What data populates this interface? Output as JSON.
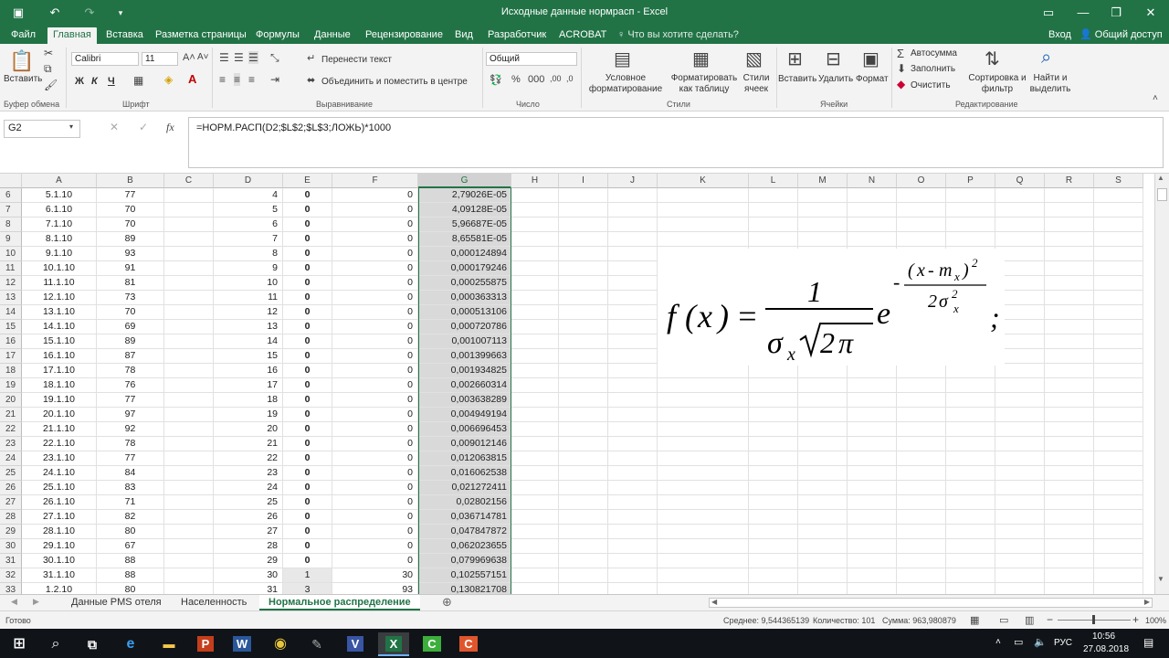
{
  "window": {
    "title": "Исходные данные нормрасп - Excel"
  },
  "menu": {
    "tabs": [
      "Файл",
      "Главная",
      "Вставка",
      "Разметка страницы",
      "Формулы",
      "Данные",
      "Рецензирование",
      "Вид",
      "Разработчик",
      "ACROBAT"
    ],
    "tell_me": "Что вы хотите сделать?",
    "signin": "Вход",
    "share": "Общий доступ"
  },
  "ribbon": {
    "paste_label": "Вставить",
    "clipboard_group": "Буфер обмена",
    "font_name": "Calibri",
    "font_size": "11",
    "font_group": "Шрифт",
    "bold": "Ж",
    "italic": "К",
    "underline": "Ч",
    "wrap_text": "Перенести текст",
    "merge_center": "Объединить и поместить в центре",
    "alignment_group": "Выравнивание",
    "number_format": "Общий",
    "number_group": "Число",
    "conditional_formatting": "Условное форматирование",
    "format_as_table": "Форматировать как таблицу",
    "cell_styles": "Стили ячеек",
    "styles_group": "Стили",
    "insert": "Вставить",
    "delete": "Удалить",
    "format": "Формат",
    "cells_group": "Ячейки",
    "autosum": "Автосумма",
    "fill": "Заполнить",
    "clear": "Очистить",
    "sort_filter": "Сортировка и фильтр",
    "find_select": "Найти и выделить",
    "editing_group": "Редактирование"
  },
  "formula_bar": {
    "name_box": "G2",
    "formula": "=НОРМ.РАСП(D2;$L$2;$L$3;ЛОЖЬ)*1000"
  },
  "columns": [
    "A",
    "B",
    "C",
    "D",
    "E",
    "F",
    "G",
    "H",
    "I",
    "J",
    "K",
    "L",
    "M",
    "N",
    "O",
    "P",
    "Q",
    "R",
    "S"
  ],
  "rows": [
    {
      "n": "6",
      "a": "5.1.10",
      "b": "77",
      "d": "4",
      "e": "0",
      "f": "0",
      "g": "2,79026E-05"
    },
    {
      "n": "7",
      "a": "6.1.10",
      "b": "70",
      "d": "5",
      "e": "0",
      "f": "0",
      "g": "4,09128E-05"
    },
    {
      "n": "8",
      "a": "7.1.10",
      "b": "70",
      "d": "6",
      "e": "0",
      "f": "0",
      "g": "5,96687E-05"
    },
    {
      "n": "9",
      "a": "8.1.10",
      "b": "89",
      "d": "7",
      "e": "0",
      "f": "0",
      "g": "8,65581E-05"
    },
    {
      "n": "10",
      "a": "9.1.10",
      "b": "93",
      "d": "8",
      "e": "0",
      "f": "0",
      "g": "0,000124894"
    },
    {
      "n": "11",
      "a": "10.1.10",
      "b": "91",
      "d": "9",
      "e": "0",
      "f": "0",
      "g": "0,000179246"
    },
    {
      "n": "12",
      "a": "11.1.10",
      "b": "81",
      "d": "10",
      "e": "0",
      "f": "0",
      "g": "0,000255875"
    },
    {
      "n": "13",
      "a": "12.1.10",
      "b": "73",
      "d": "11",
      "e": "0",
      "f": "0",
      "g": "0,000363313"
    },
    {
      "n": "14",
      "a": "13.1.10",
      "b": "70",
      "d": "12",
      "e": "0",
      "f": "0",
      "g": "0,000513106"
    },
    {
      "n": "15",
      "a": "14.1.10",
      "b": "69",
      "d": "13",
      "e": "0",
      "f": "0",
      "g": "0,000720786"
    },
    {
      "n": "16",
      "a": "15.1.10",
      "b": "89",
      "d": "14",
      "e": "0",
      "f": "0",
      "g": "0,001007113"
    },
    {
      "n": "17",
      "a": "16.1.10",
      "b": "87",
      "d": "15",
      "e": "0",
      "f": "0",
      "g": "0,001399663"
    },
    {
      "n": "18",
      "a": "17.1.10",
      "b": "78",
      "d": "16",
      "e": "0",
      "f": "0",
      "g": "0,001934825"
    },
    {
      "n": "19",
      "a": "18.1.10",
      "b": "76",
      "d": "17",
      "e": "0",
      "f": "0",
      "g": "0,002660314"
    },
    {
      "n": "20",
      "a": "19.1.10",
      "b": "77",
      "d": "18",
      "e": "0",
      "f": "0",
      "g": "0,003638289"
    },
    {
      "n": "21",
      "a": "20.1.10",
      "b": "97",
      "d": "19",
      "e": "0",
      "f": "0",
      "g": "0,004949194"
    },
    {
      "n": "22",
      "a": "21.1.10",
      "b": "92",
      "d": "20",
      "e": "0",
      "f": "0",
      "g": "0,006696453"
    },
    {
      "n": "23",
      "a": "22.1.10",
      "b": "78",
      "d": "21",
      "e": "0",
      "f": "0",
      "g": "0,009012146"
    },
    {
      "n": "24",
      "a": "23.1.10",
      "b": "77",
      "d": "22",
      "e": "0",
      "f": "0",
      "g": "0,012063815"
    },
    {
      "n": "25",
      "a": "24.1.10",
      "b": "84",
      "d": "23",
      "e": "0",
      "f": "0",
      "g": "0,016062538"
    },
    {
      "n": "26",
      "a": "25.1.10",
      "b": "83",
      "d": "24",
      "e": "0",
      "f": "0",
      "g": "0,021272411"
    },
    {
      "n": "27",
      "a": "26.1.10",
      "b": "71",
      "d": "25",
      "e": "0",
      "f": "0",
      "g": "0,02802156"
    },
    {
      "n": "28",
      "a": "27.1.10",
      "b": "82",
      "d": "26",
      "e": "0",
      "f": "0",
      "g": "0,036714781"
    },
    {
      "n": "29",
      "a": "28.1.10",
      "b": "80",
      "d": "27",
      "e": "0",
      "f": "0",
      "g": "0,047847872"
    },
    {
      "n": "30",
      "a": "29.1.10",
      "b": "67",
      "d": "28",
      "e": "0",
      "f": "0",
      "g": "0,062023655"
    },
    {
      "n": "31",
      "a": "30.1.10",
      "b": "88",
      "d": "29",
      "e": "0",
      "f": "0",
      "g": "0,079969638"
    },
    {
      "n": "32",
      "a": "31.1.10",
      "b": "88",
      "d": "30",
      "e": "1",
      "f": "30",
      "g": "0,102557151"
    },
    {
      "n": "33",
      "a": "1.2.10",
      "b": "80",
      "d": "31",
      "e": "3",
      "f": "93",
      "g": "0,130821708"
    }
  ],
  "sheets": [
    "Данные PMS отеля",
    "Населенность",
    "Нормальное распределение"
  ],
  "active_sheet": "Нормальное распределение",
  "status": {
    "ready": "Готово",
    "average": "Среднее: 9,544365139",
    "count": "Количество: 101",
    "sum": "Сумма: 963,980879",
    "zoom": "100%"
  },
  "taskbar": {
    "time": "10:56",
    "date": "27.08.2018",
    "lang": "РУС"
  }
}
